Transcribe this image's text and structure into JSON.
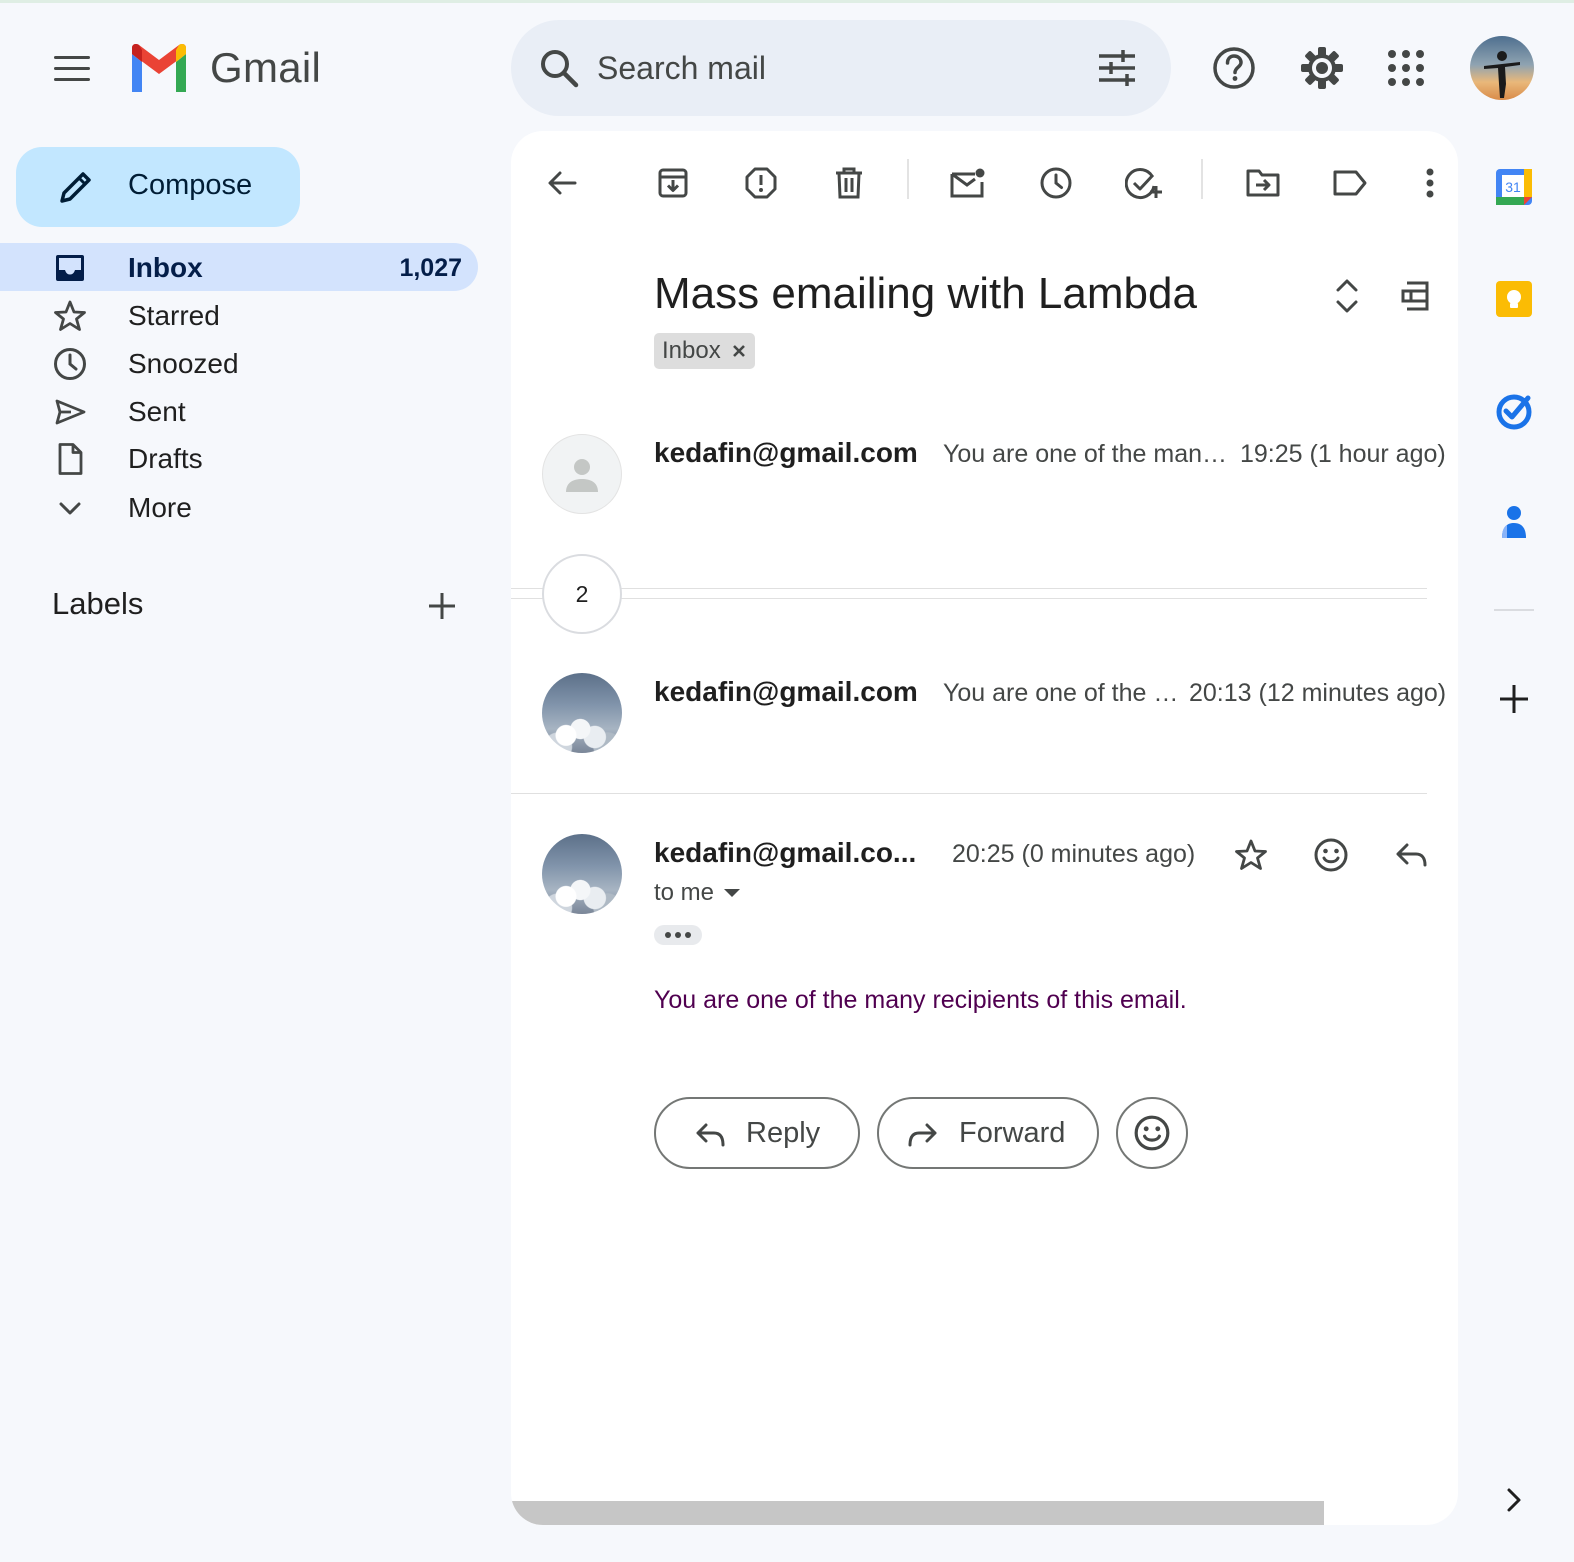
{
  "app": {
    "name": "Gmail"
  },
  "search": {
    "placeholder": "Search mail"
  },
  "compose": {
    "label": "Compose"
  },
  "sidebar": {
    "items": [
      {
        "label": "Inbox",
        "count": "1,027",
        "icon": "inbox-icon",
        "active": true
      },
      {
        "label": "Starred",
        "icon": "star-icon"
      },
      {
        "label": "Snoozed",
        "icon": "clock-icon"
      },
      {
        "label": "Sent",
        "icon": "send-icon"
      },
      {
        "label": "Drafts",
        "icon": "draft-icon"
      },
      {
        "label": "More",
        "icon": "chevron-down-icon"
      }
    ],
    "labels_title": "Labels"
  },
  "thread": {
    "subject": "Mass emailing with Lambda",
    "chip": "Inbox",
    "collapsed_count": "2",
    "messages": [
      {
        "sender": "kedafin@gmail.com",
        "snippet": "You are one of the many recipients of this email.",
        "time": "19:25 (1 hour ago)"
      },
      {
        "sender": "kedafin@gmail.com",
        "snippet": "You are one of the many recipients of this email.",
        "time": "20:13 (12 minutes ago)"
      },
      {
        "sender": "kedafin@gmail.co...",
        "time": "20:25 (0 minutes ago)",
        "to": "to me",
        "body": "You are one of the many recipients of this email."
      }
    ],
    "actions": {
      "reply": "Reply",
      "forward": "Forward"
    }
  },
  "rail": {
    "calendar_day": "31"
  },
  "colors": {
    "background": "#f6f8fc",
    "compose": "#c2e7ff",
    "active_nav": "#d3e3fd",
    "body_text": "#500050",
    "keep": "#fbbc04",
    "tasks": "#1a73e8",
    "contacts": "#1a73e8"
  }
}
